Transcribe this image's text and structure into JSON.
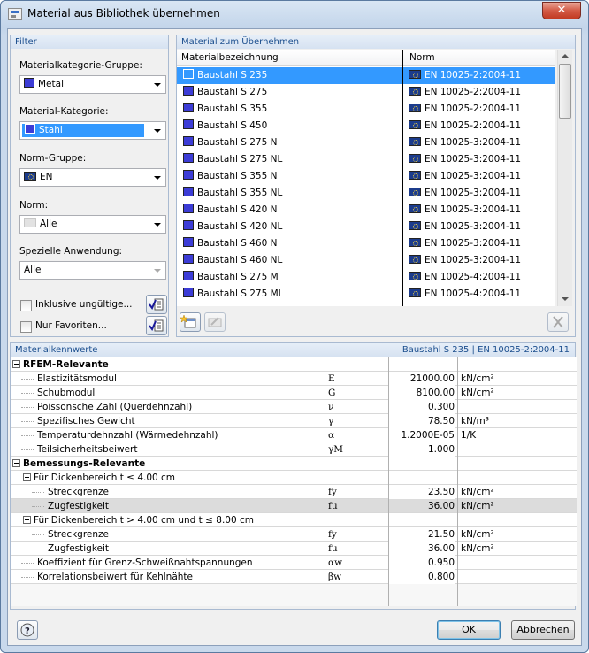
{
  "window": {
    "title": "Material aus Bibliothek übernehmen",
    "close_label": "✕"
  },
  "filter": {
    "header": "Filter",
    "category_group_label": "Materialkategorie-Gruppe:",
    "category_group_value": "Metall",
    "category_label": "Material-Kategorie:",
    "category_value": "Stahl",
    "norm_group_label": "Norm-Gruppe:",
    "norm_group_value": "EN",
    "norm_label": "Norm:",
    "norm_value": "Alle",
    "special_label": "Spezielle Anwendung:",
    "special_value": "Alle",
    "include_invalid_label": "Inklusive ungültige...",
    "only_favorites_label": "Nur Favoriten..."
  },
  "materials": {
    "header": "Material zum Übernehmen",
    "col_name": "Materialbezeichnung",
    "col_norm": "Norm",
    "rows": [
      {
        "name": "Baustahl S 235",
        "norm": "EN 10025-2:2004-11"
      },
      {
        "name": "Baustahl S 275",
        "norm": "EN 10025-2:2004-11"
      },
      {
        "name": "Baustahl S 355",
        "norm": "EN 10025-2:2004-11"
      },
      {
        "name": "Baustahl S 450",
        "norm": "EN 10025-2:2004-11"
      },
      {
        "name": "Baustahl S 275 N",
        "norm": "EN 10025-3:2004-11"
      },
      {
        "name": "Baustahl S 275 NL",
        "norm": "EN 10025-3:2004-11"
      },
      {
        "name": "Baustahl S 355 N",
        "norm": "EN 10025-3:2004-11"
      },
      {
        "name": "Baustahl S 355 NL",
        "norm": "EN 10025-3:2004-11"
      },
      {
        "name": "Baustahl S 420 N",
        "norm": "EN 10025-3:2004-11"
      },
      {
        "name": "Baustahl S 420 NL",
        "norm": "EN 10025-3:2004-11"
      },
      {
        "name": "Baustahl S 460 N",
        "norm": "EN 10025-3:2004-11"
      },
      {
        "name": "Baustahl S 460 NL",
        "norm": "EN 10025-3:2004-11"
      },
      {
        "name": "Baustahl S 275 M",
        "norm": "EN 10025-4:2004-11"
      },
      {
        "name": "Baustahl S 275 ML",
        "norm": "EN 10025-4:2004-11"
      }
    ]
  },
  "props": {
    "header": "Materialkennwerte",
    "selection": "Baustahl S 235 | EN 10025-2:2004-11",
    "g1": "RFEM-Relevante",
    "g2": "Bemessungs-Relevante",
    "sub1": "Für Dickenbereich t ≤ 4.00 cm",
    "sub2": "Für Dickenbereich t > 4.00 cm und t ≤ 8.00 cm",
    "rows1": [
      {
        "name": "Elastizitätsmodul",
        "sym": "E",
        "val": "21000.00",
        "unit": "kN/cm²"
      },
      {
        "name": "Schubmodul",
        "sym": "G",
        "val": "8100.00",
        "unit": "kN/cm²"
      },
      {
        "name": "Poissonsche Zahl (Querdehnzahl)",
        "sym": "ν",
        "val": "0.300",
        "unit": ""
      },
      {
        "name": "Spezifisches Gewicht",
        "sym": "γ",
        "val": "78.50",
        "unit": "kN/m³"
      },
      {
        "name": "Temperaturdehnzahl (Wärmedehnzahl)",
        "sym": "α",
        "val": "1.2000E-05",
        "unit": "1/K"
      },
      {
        "name": "Teilsicherheitsbeiwert",
        "sym": "γM",
        "val": "1.000",
        "unit": ""
      }
    ],
    "rows_sub1": [
      {
        "name": "Streckgrenze",
        "sym": "fy",
        "val": "23.50",
        "unit": "kN/cm²"
      },
      {
        "name": "Zugfestigkeit",
        "sym": "fu",
        "val": "36.00",
        "unit": "kN/cm²"
      }
    ],
    "rows_sub2": [
      {
        "name": "Streckgrenze",
        "sym": "fy",
        "val": "21.50",
        "unit": "kN/cm²"
      },
      {
        "name": "Zugfestigkeit",
        "sym": "fu",
        "val": "36.00",
        "unit": "kN/cm²"
      }
    ],
    "rows2": [
      {
        "name": "Koeffizient für Grenz-Schweißnahtspannungen",
        "sym": "αw",
        "val": "0.950",
        "unit": ""
      },
      {
        "name": "Korrelationsbeiwert für Kehlnähte",
        "sym": "βw",
        "val": "0.800",
        "unit": ""
      }
    ]
  },
  "footer": {
    "ok_label": "OK",
    "cancel_label": "Abbrechen"
  }
}
